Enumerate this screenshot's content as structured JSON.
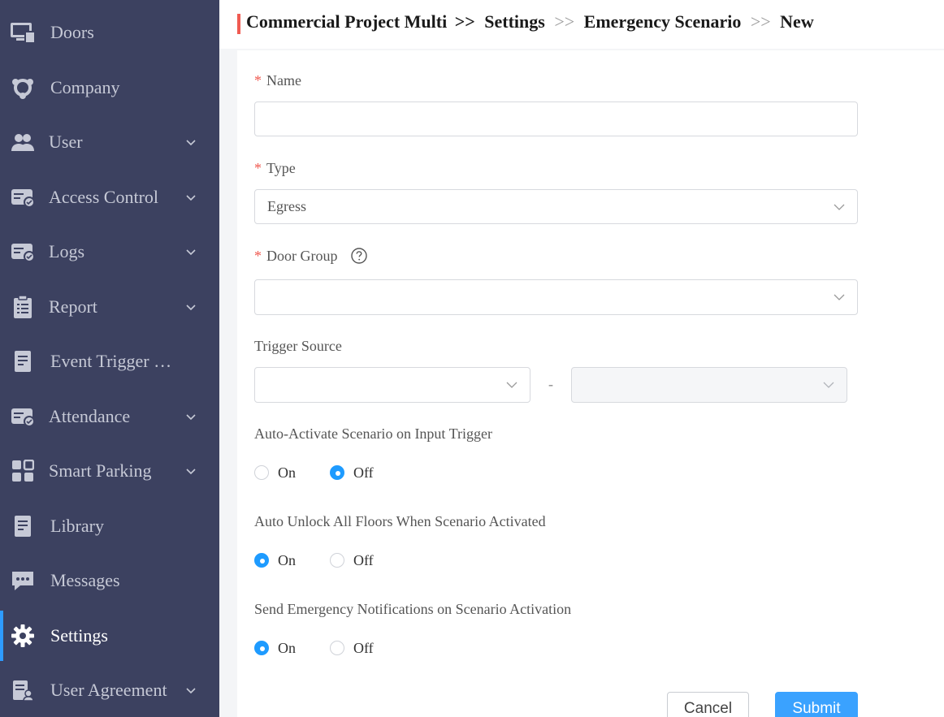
{
  "sidebar": {
    "items": [
      {
        "label": "Doors",
        "icon": "monitor-door-icon",
        "has_submenu": false,
        "active": false
      },
      {
        "label": "Company",
        "icon": "company-icon",
        "has_submenu": false,
        "active": false
      },
      {
        "label": "User",
        "icon": "users-icon",
        "has_submenu": true,
        "active": false
      },
      {
        "label": "Access Control",
        "icon": "access-card-icon",
        "has_submenu": true,
        "active": false
      },
      {
        "label": "Logs",
        "icon": "logs-card-icon",
        "has_submenu": true,
        "active": false
      },
      {
        "label": "Report",
        "icon": "clipboard-icon",
        "has_submenu": true,
        "active": false
      },
      {
        "label": "Event Trigger …",
        "icon": "document-icon",
        "has_submenu": false,
        "active": false
      },
      {
        "label": "Attendance",
        "icon": "attendance-card-icon",
        "has_submenu": true,
        "active": false
      },
      {
        "label": "Smart Parking",
        "icon": "grid-icon",
        "has_submenu": true,
        "active": false
      },
      {
        "label": "Library",
        "icon": "library-doc-icon",
        "has_submenu": false,
        "active": false
      },
      {
        "label": "Messages",
        "icon": "chat-icon",
        "has_submenu": false,
        "active": false
      },
      {
        "label": "Settings",
        "icon": "gear-icon",
        "has_submenu": false,
        "active": true
      },
      {
        "label": "User Agreement",
        "icon": "agreement-icon",
        "has_submenu": true,
        "active": false
      }
    ],
    "accent_color": "#2e9bff",
    "background": "#3c4160"
  },
  "breadcrumb": {
    "items": [
      "Commercial Project Multi",
      "Settings",
      "Emergency Scenario",
      "New"
    ],
    "separator": ">>"
  },
  "form": {
    "name": {
      "label": "Name",
      "required": true,
      "value": ""
    },
    "type": {
      "label": "Type",
      "required": true,
      "value": "Egress"
    },
    "door_group": {
      "label": "Door Group",
      "required": true,
      "value": ""
    },
    "trigger_source": {
      "label": "Trigger Source",
      "value_left": "",
      "value_right": "",
      "separator": "-"
    },
    "auto_activate": {
      "label": "Auto-Activate Scenario on Input Trigger",
      "options": [
        "On",
        "Off"
      ],
      "selected": "Off"
    },
    "auto_unlock": {
      "label": "Auto Unlock All Floors When Scenario Activated",
      "options": [
        "On",
        "Off"
      ],
      "selected": "On"
    },
    "send_notifications": {
      "label": "Send Emergency Notifications on Scenario Activation",
      "options": [
        "On",
        "Off"
      ],
      "selected": "On"
    },
    "required_mark": "*"
  },
  "actions": {
    "cancel": "Cancel",
    "submit": "Submit"
  },
  "colors": {
    "primary": "#1e9bff",
    "required": "#f05b52"
  }
}
